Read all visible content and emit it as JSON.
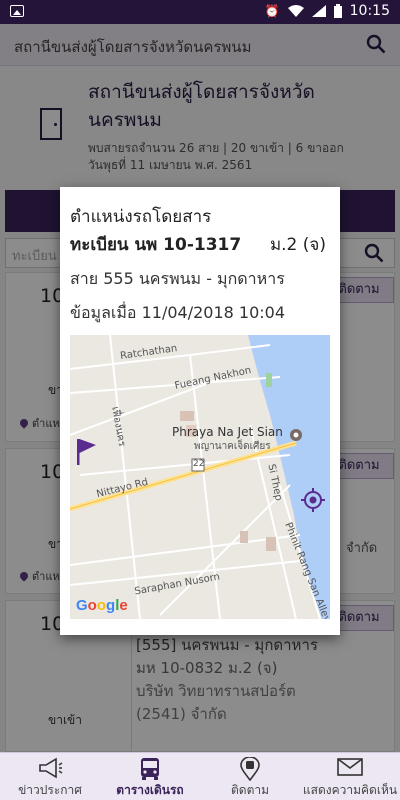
{
  "status_bar": {
    "time": "10:15",
    "icons": [
      "image-icon",
      "alarm-icon",
      "wifi-icon",
      "signal-icon",
      "battery-icon"
    ]
  },
  "header": {
    "search_text": "สถานีขนส่งผู้โดยสารจังหวัดนครพนม"
  },
  "station": {
    "title": "สถานีขนส่งผู้โดยสารจังหวัดนครพนม",
    "summary": "พบสายรถจำนวน 26 สาย | 20 ขาเข้า | 6 ขาออก",
    "date": "วันพุธที่ 11 เมษายน พ.ศ. 2561"
  },
  "filter": {
    "placeholder": "ทะเบียน"
  },
  "rows": [
    {
      "num": "10",
      "direction": "ขาเข้า",
      "location": "ตำแหน่ง",
      "tag": "ติดตาม"
    },
    {
      "num": "10",
      "direction": "ขาเข้า",
      "location": "ตำแหน่ง",
      "tag": "ติดตาม",
      "company_tail": "จำกัด"
    },
    {
      "num": "10",
      "direction": "ขาเข้า",
      "tag": "ติดตาม",
      "detail_line1": "[555] นครพนม - มุกดาหาร",
      "detail_line2": "มห 10-0832          ม.2 (จ)",
      "detail_line3": "บริษัท วิทยาทรานสปอร์ต",
      "detail_line4": "(2541) จำกัด"
    }
  ],
  "dialog": {
    "title": "ตำแหน่งรถโดยสาร",
    "plate": "ทะเบียน นพ 10-1317",
    "class": "ม.2 (จ)",
    "route": "สาย 555 นครพนม - มุกดาหาร",
    "updated": "ข้อมูลเมื่อ 11/04/2018 10:04",
    "map": {
      "labels": [
        "Ratchathan",
        "Fueang Nakhon",
        "Nittayo Rd",
        "Si Thep",
        "Saraphan Nusorn",
        "Phinit Rang San Alley",
        "เฟื่องนคร",
        "22"
      ],
      "poi_name": "Phraya Na Jet Sian",
      "poi_name_th": "พญานาคเจ็ดเศียร",
      "attribution": [
        "G",
        "o",
        "o",
        "g",
        "l",
        "e"
      ],
      "water_color": "#aecdf7",
      "marker_color": "#5b2c90"
    }
  },
  "bottom_nav": {
    "items": [
      {
        "label": "ข่าวประกาศ",
        "icon": "megaphone-icon"
      },
      {
        "label": "ตารางเดินรถ",
        "icon": "bus-icon"
      },
      {
        "label": "ติดตาม",
        "icon": "bus-location-icon"
      },
      {
        "label": "แสดงความคิดเห็น",
        "icon": "envelope-icon"
      }
    ],
    "active_index": 1
  },
  "colors": {
    "brand": "#3a2359",
    "status_bar": "#25143a"
  }
}
